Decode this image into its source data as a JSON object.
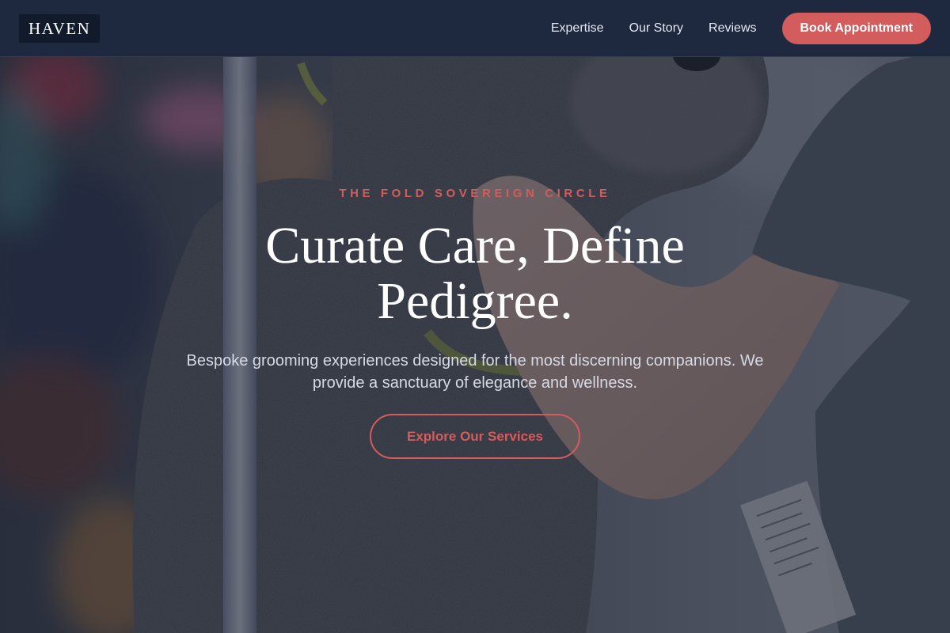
{
  "navbar": {
    "logo": "HAVEN",
    "links": [
      "Expertise",
      "Our Story",
      "Reviews"
    ],
    "cta_label": "Book Appointment"
  },
  "hero": {
    "eyebrow": "THE FOLD SOVEREIGN CIRCLE",
    "title": "Curate Care, Define Pedigree.",
    "subtitle": "Bespoke grooming experiences designed for the most discerning companions. We provide a sanctuary of elegance and wellness.",
    "button_label": "Explore Our Services",
    "background_image": "dog-grooming-photo"
  },
  "colors": {
    "navbar_bg": "#1e2940",
    "logo_bg": "#121b2c",
    "accent": "#d35c5c",
    "overlay": "#1c2234",
    "text_light": "#ffffff"
  }
}
